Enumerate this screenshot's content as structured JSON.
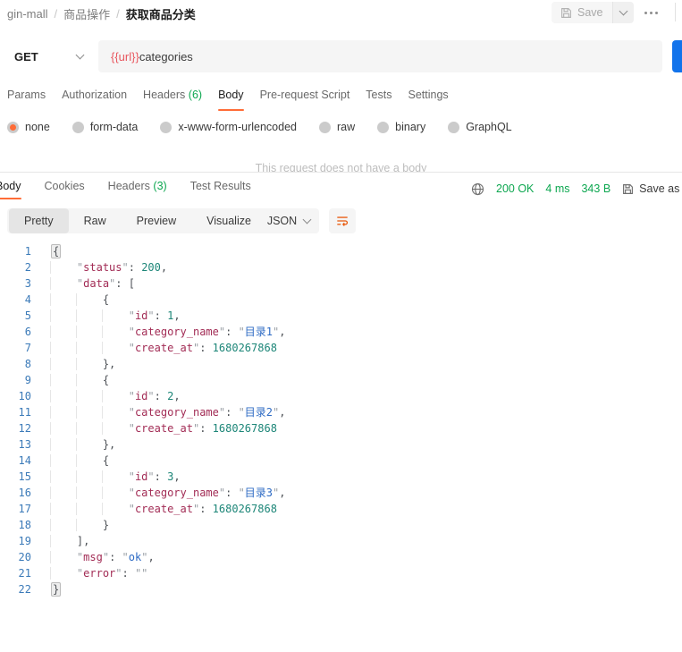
{
  "header": {
    "breadcrumb": [
      "gin-mall",
      "商品操作",
      "获取商品分类"
    ],
    "separator": "/",
    "save_label": "Save"
  },
  "request": {
    "method": "GET",
    "url_variable": "{{url}}",
    "url_path": "categories",
    "tabs": [
      {
        "label": "Params",
        "active": false
      },
      {
        "label": "Authorization",
        "active": false
      },
      {
        "label": "Headers",
        "count": "(6)",
        "active": false
      },
      {
        "label": "Body",
        "active": true
      },
      {
        "label": "Pre-request Script",
        "active": false
      },
      {
        "label": "Tests",
        "active": false
      },
      {
        "label": "Settings",
        "active": false
      }
    ],
    "body_types": [
      {
        "label": "none",
        "selected": true
      },
      {
        "label": "form-data",
        "selected": false
      },
      {
        "label": "x-www-form-urlencoded",
        "selected": false
      },
      {
        "label": "raw",
        "selected": false
      },
      {
        "label": "binary",
        "selected": false
      },
      {
        "label": "GraphQL",
        "selected": false
      }
    ],
    "empty_message": "This request does not have a body"
  },
  "response": {
    "tabs": [
      {
        "label": "Body",
        "active": true
      },
      {
        "label": "Cookies",
        "active": false
      },
      {
        "label": "Headers",
        "count": "(3)",
        "active": false
      },
      {
        "label": "Test Results",
        "active": false
      }
    ],
    "status": "200 OK",
    "time": "4 ms",
    "size": "343 B",
    "save_as_label": "Save as",
    "views": [
      {
        "label": "Pretty",
        "active": true
      },
      {
        "label": "Raw",
        "active": false
      },
      {
        "label": "Preview",
        "active": false
      },
      {
        "label": "Visualize",
        "active": false
      }
    ],
    "format": "JSON",
    "code": {
      "lines": [
        {
          "n": 1,
          "g": 0,
          "t": [
            [
              "m",
              "{"
            ]
          ]
        },
        {
          "n": 2,
          "g": 1,
          "t": [
            [
              "q",
              "\""
            ],
            [
              "k",
              "status"
            ],
            [
              "q",
              "\""
            ],
            [
              "p",
              ": "
            ],
            [
              "n",
              "200"
            ],
            [
              "p",
              ","
            ]
          ]
        },
        {
          "n": 3,
          "g": 1,
          "t": [
            [
              "q",
              "\""
            ],
            [
              "k",
              "data"
            ],
            [
              "q",
              "\""
            ],
            [
              "p",
              ": ["
            ]
          ]
        },
        {
          "n": 4,
          "g": 2,
          "t": [
            [
              "p",
              "{"
            ]
          ]
        },
        {
          "n": 5,
          "g": 3,
          "t": [
            [
              "q",
              "\""
            ],
            [
              "k",
              "id"
            ],
            [
              "q",
              "\""
            ],
            [
              "p",
              ": "
            ],
            [
              "n",
              "1"
            ],
            [
              "p",
              ","
            ]
          ]
        },
        {
          "n": 6,
          "g": 3,
          "t": [
            [
              "q",
              "\""
            ],
            [
              "k",
              "category_name"
            ],
            [
              "q",
              "\""
            ],
            [
              "p",
              ": "
            ],
            [
              "q",
              "\""
            ],
            [
              "s",
              "目录1"
            ],
            [
              "q",
              "\""
            ],
            [
              "p",
              ","
            ]
          ]
        },
        {
          "n": 7,
          "g": 3,
          "t": [
            [
              "q",
              "\""
            ],
            [
              "k",
              "create_at"
            ],
            [
              "q",
              "\""
            ],
            [
              "p",
              ": "
            ],
            [
              "n",
              "1680267868"
            ]
          ]
        },
        {
          "n": 8,
          "g": 2,
          "t": [
            [
              "p",
              "},"
            ]
          ]
        },
        {
          "n": 9,
          "g": 2,
          "t": [
            [
              "p",
              "{"
            ]
          ]
        },
        {
          "n": 10,
          "g": 3,
          "t": [
            [
              "q",
              "\""
            ],
            [
              "k",
              "id"
            ],
            [
              "q",
              "\""
            ],
            [
              "p",
              ": "
            ],
            [
              "n",
              "2"
            ],
            [
              "p",
              ","
            ]
          ]
        },
        {
          "n": 11,
          "g": 3,
          "t": [
            [
              "q",
              "\""
            ],
            [
              "k",
              "category_name"
            ],
            [
              "q",
              "\""
            ],
            [
              "p",
              ": "
            ],
            [
              "q",
              "\""
            ],
            [
              "s",
              "目录2"
            ],
            [
              "q",
              "\""
            ],
            [
              "p",
              ","
            ]
          ]
        },
        {
          "n": 12,
          "g": 3,
          "t": [
            [
              "q",
              "\""
            ],
            [
              "k",
              "create_at"
            ],
            [
              "q",
              "\""
            ],
            [
              "p",
              ": "
            ],
            [
              "n",
              "1680267868"
            ]
          ]
        },
        {
          "n": 13,
          "g": 2,
          "t": [
            [
              "p",
              "},"
            ]
          ]
        },
        {
          "n": 14,
          "g": 2,
          "t": [
            [
              "p",
              "{"
            ]
          ]
        },
        {
          "n": 15,
          "g": 3,
          "t": [
            [
              "q",
              "\""
            ],
            [
              "k",
              "id"
            ],
            [
              "q",
              "\""
            ],
            [
              "p",
              ": "
            ],
            [
              "n",
              "3"
            ],
            [
              "p",
              ","
            ]
          ]
        },
        {
          "n": 16,
          "g": 3,
          "t": [
            [
              "q",
              "\""
            ],
            [
              "k",
              "category_name"
            ],
            [
              "q",
              "\""
            ],
            [
              "p",
              ": "
            ],
            [
              "q",
              "\""
            ],
            [
              "s",
              "目录3"
            ],
            [
              "q",
              "\""
            ],
            [
              "p",
              ","
            ]
          ]
        },
        {
          "n": 17,
          "g": 3,
          "t": [
            [
              "q",
              "\""
            ],
            [
              "k",
              "create_at"
            ],
            [
              "q",
              "\""
            ],
            [
              "p",
              ": "
            ],
            [
              "n",
              "1680267868"
            ]
          ]
        },
        {
          "n": 18,
          "g": 2,
          "t": [
            [
              "p",
              "}"
            ]
          ]
        },
        {
          "n": 19,
          "g": 1,
          "t": [
            [
              "p",
              "],"
            ]
          ]
        },
        {
          "n": 20,
          "g": 1,
          "t": [
            [
              "q",
              "\""
            ],
            [
              "k",
              "msg"
            ],
            [
              "q",
              "\""
            ],
            [
              "p",
              ": "
            ],
            [
              "q",
              "\""
            ],
            [
              "s",
              "ok"
            ],
            [
              "q",
              "\""
            ],
            [
              "p",
              ","
            ]
          ]
        },
        {
          "n": 21,
          "g": 1,
          "t": [
            [
              "q",
              "\""
            ],
            [
              "k",
              "error"
            ],
            [
              "q",
              "\""
            ],
            [
              "p",
              ": "
            ],
            [
              "q",
              "\"\""
            ]
          ]
        },
        {
          "n": 22,
          "g": 0,
          "t": [
            [
              "m",
              "}"
            ]
          ]
        }
      ]
    }
  },
  "colors": {
    "accent_orange": "#ff6c37",
    "success_green": "#0da750",
    "send_blue": "#1273eb",
    "variable_red": "#e8565e"
  }
}
